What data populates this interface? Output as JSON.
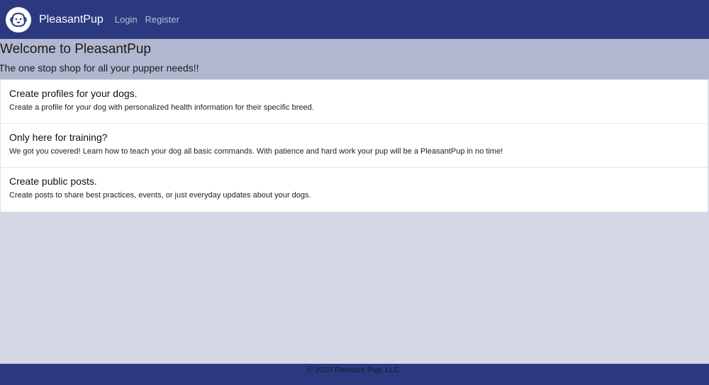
{
  "navbar": {
    "brand": "PleasantPup",
    "links": [
      "Login",
      "Register"
    ]
  },
  "hero": {
    "title": "Welcome to PleasantPup",
    "subtitle": "The one stop shop for all your pupper needs!!"
  },
  "features": [
    {
      "title": "Create profiles for your dogs.",
      "text": "Create a profile for your dog with personalized health information for their specific breed."
    },
    {
      "title": "Only here for training?",
      "text": "We got you covered! Learn how to teach your dog all basic commands. With patience and hard work your pup will be a PleasantPup in no time!"
    },
    {
      "title": "Create public posts.",
      "text": "Create posts to share best practices, events, or just everyday updates about your dogs."
    }
  ],
  "footer": {
    "copyright": "© 2019 Pleasant Pup, LLC."
  },
  "icons": {
    "logo": "dog-logo-icon"
  },
  "colors": {
    "navbar": "#2b3a80",
    "hero": "#b2b7d0",
    "page": "#d4d7e6"
  }
}
